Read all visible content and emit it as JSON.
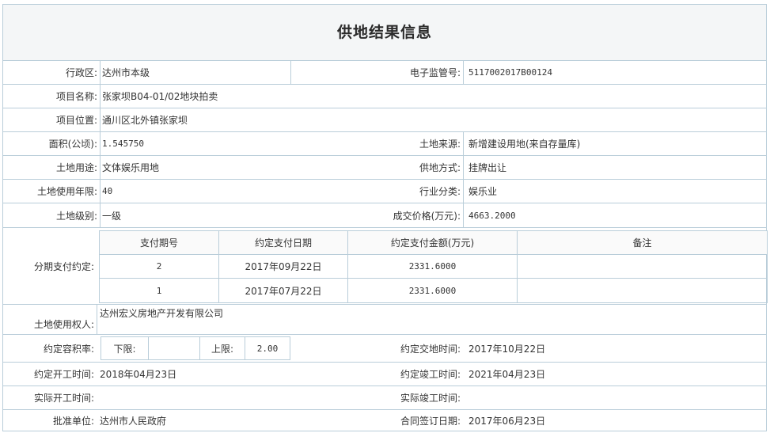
{
  "title": "供地结果信息",
  "row1": {
    "district_label": "行政区:",
    "district_value": "达州市本级",
    "supervision_label": "电子监管号:",
    "supervision_value": "5117002017B00124"
  },
  "row2": {
    "project_name_label": "项目名称:",
    "project_name_value": "张家坝B04-01/02地块拍卖"
  },
  "row3": {
    "project_location_label": "项目位置:",
    "project_location_value": "通川区北外镇张家坝"
  },
  "row4": {
    "area_label": "面积(公顷):",
    "area_value": "1.545750",
    "land_source_label": "土地来源:",
    "land_source_value": "新增建设用地(来自存量库)"
  },
  "row5": {
    "land_use_label": "土地用途:",
    "land_use_value": "文体娱乐用地",
    "supply_method_label": "供地方式:",
    "supply_method_value": "挂牌出让"
  },
  "row6": {
    "use_years_label": "土地使用年限:",
    "use_years_value": "40",
    "industry_label": "行业分类:",
    "industry_value": "娱乐业"
  },
  "row7": {
    "land_grade_label": "土地级别:",
    "land_grade_value": "一级",
    "deal_price_label": "成交价格(万元):",
    "deal_price_value": "4663.2000"
  },
  "installment": {
    "label": "分期支付约定:",
    "headers": [
      "支付期号",
      "约定支付日期",
      "约定支付金额(万元)",
      "备注"
    ],
    "rows": [
      {
        "period": "2",
        "date": "2017年09月22日",
        "amount": "2331.6000",
        "note": ""
      },
      {
        "period": "1",
        "date": "2017年07月22日",
        "amount": "2331.6000",
        "note": ""
      }
    ]
  },
  "land_user": {
    "label": "土地使用权人:",
    "value": "达州宏义房地产开发有限公司"
  },
  "plot_ratio": {
    "label": "约定容积率:",
    "lower_label": "下限:",
    "lower_value": "",
    "upper_label": "上限:",
    "upper_value": "2.00",
    "delivery_label": "约定交地时间:",
    "delivery_value": "2017年10月22日"
  },
  "start_row": {
    "start_label": "约定开工时间:",
    "start_value": "2018年04月23日",
    "finish_label": "约定竣工时间:",
    "finish_value": "2021年04月23日"
  },
  "actual_row": {
    "actual_start_label": "实际开工时间:",
    "actual_start_value": "",
    "actual_finish_label": "实际竣工时间:",
    "actual_finish_value": ""
  },
  "approval_row": {
    "approval_label": "批准单位:",
    "approval_value": "达州市人民政府",
    "contract_label": "合同签订日期:",
    "contract_value": "2017年06月23日"
  }
}
